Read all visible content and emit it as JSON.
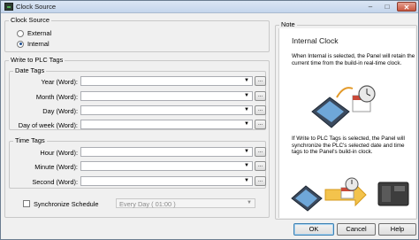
{
  "window": {
    "title": "Clock Source"
  },
  "clock_source": {
    "legend": "Clock Source",
    "options": [
      {
        "label": "External",
        "selected": false
      },
      {
        "label": "Internal",
        "selected": true
      }
    ]
  },
  "write_to_plc": {
    "legend": "Write to PLC Tags",
    "date_tags": {
      "legend": "Date Tags",
      "rows": [
        {
          "label": "Year (Word):",
          "value": ""
        },
        {
          "label": "Month (Word):",
          "value": ""
        },
        {
          "label": "Day (Word):",
          "value": ""
        },
        {
          "label": "Day of week (Word):",
          "value": ""
        }
      ]
    },
    "time_tags": {
      "legend": "Time Tags",
      "rows": [
        {
          "label": "Hour (Word):",
          "value": ""
        },
        {
          "label": "Minute (Word):",
          "value": ""
        },
        {
          "label": "Second (Word):",
          "value": ""
        }
      ]
    },
    "sync": {
      "label": "Synchronize Schedule",
      "checked": false,
      "schedule_value": "Every Day ( 01:00 )"
    }
  },
  "note": {
    "legend": "Note",
    "title": "Internal Clock",
    "text1": "When Internal is selected, the Panel will retain the current time from the build-in real-time clock.",
    "text2": "If Write to PLC Tags is selected, the Panel will synchronize the PLC's selected date and time tags to the Panel's build-in clock."
  },
  "buttons": {
    "ok": "OK",
    "cancel": "Cancel",
    "help": "Help"
  },
  "glyphs": {
    "dropdown": "▼",
    "browse": "...",
    "minimize": "–",
    "maximize": "□",
    "close": "✕"
  },
  "colors": {
    "title_bar": "#c4d5ec",
    "close_button": "#c9573f",
    "accent": "#3c7fb1"
  }
}
